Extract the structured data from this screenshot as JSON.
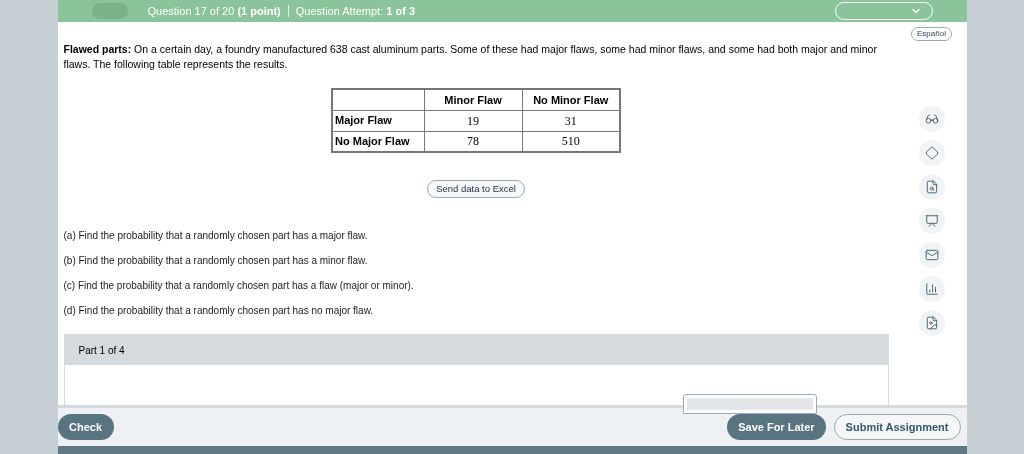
{
  "header": {
    "question": "Question 17 of 20",
    "points": "(1 point)",
    "attempt_label": "Question Attempt:",
    "attempt": "1 of 3"
  },
  "language_button": "Español",
  "problem": {
    "intro": "**Flawed parts:** On a certain day, a foundry manufactured 638 cast aluminum parts. Some of these had major flaws, some had minor flaws, and some had both major and minor flaws. The following table represents the results."
  },
  "table": {
    "columns": [
      "Minor Flaw",
      "No Minor Flaw"
    ],
    "rows": [
      {
        "label": "Major Flaw",
        "cells": [
          "19",
          "31"
        ]
      },
      {
        "label": "No Major Flaw",
        "cells": [
          "78",
          "510"
        ]
      }
    ]
  },
  "excel_button": "Send data to Excel",
  "questions": [
    "(a) Find the probability that a randomly chosen part has a major flaw.",
    "(b) Find the probability that a randomly chosen part has a minor flaw.",
    "(c) Find the probability that a randomly chosen part has a flaw (major or minor).",
    "(d) Find the probability that a randomly chosen part has no major flaw."
  ],
  "part_label": "Part 1 of 4",
  "footer": {
    "check": "Check",
    "save": "Save For Later",
    "submit": "Submit Assignment"
  }
}
